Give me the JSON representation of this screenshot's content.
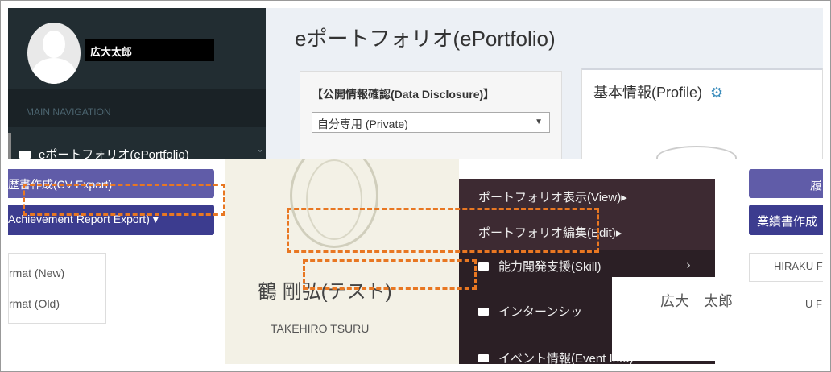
{
  "sidebar": {
    "username": "広大太郎",
    "nav_header": "MAIN NAVIGATION",
    "portfolio_item": "eポートフォリオ(ePortfolio)",
    "small_caret": "ˇ"
  },
  "header": {
    "page_title": "eポートフォリオ(ePortfolio)"
  },
  "disclosure": {
    "label": "【公開情報確認(Data Disclosure)】",
    "selected": "自分専用 (Private)"
  },
  "profile": {
    "title": "基本情報(Profile)"
  },
  "buttons": {
    "cv_export": "歴書作成(CV Export)",
    "achievement_export": "Achievement Report Export) ▾",
    "format_new": "rmat (New)",
    "format_old": "rmat (Old)"
  },
  "person": {
    "name": "鶴 剛弘(テスト)",
    "romaji": "TAKEHIRO TSURU"
  },
  "menu": {
    "view": "ポートフォリオ表示(View)▸",
    "edit": "ポートフォリオ編集(Edit)▸",
    "skill": "能力開発支援(Skill)",
    "internship": "インターンシッ",
    "event": "イベント情報(Event Info)",
    "chevron": "›"
  },
  "tooltip": {
    "name": "広大　太郎"
  },
  "right_side": {
    "purple_btn": "履",
    "navy_btn": "業績書作成",
    "hiraku": "HIRAKU F",
    "u_frag": "U F"
  },
  "colors": {
    "sidebar_bg": "#222d32",
    "purple": "#605ca8",
    "navy": "#3c3c8f",
    "menu_bg": "#3d2a32",
    "annotation": "#e87722"
  }
}
